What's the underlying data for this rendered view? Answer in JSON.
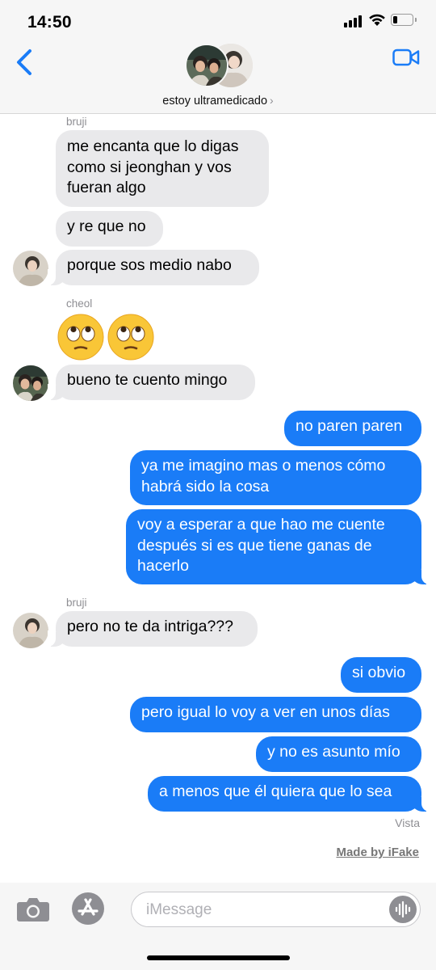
{
  "status_bar": {
    "time": "14:50",
    "battery_level": 0.25
  },
  "header": {
    "conversation_name": "estoy ultramedicado",
    "chevron": "›",
    "back_icon": "chevron-left-icon",
    "video_icon": "video-camera-icon",
    "accent_color": "#1a7cf7"
  },
  "messages": [
    {
      "sender": "bruji",
      "direction": "incoming",
      "text": "me encanta que lo digas\ncomo si jeonghan y vos\nfueran algo"
    },
    {
      "direction": "incoming",
      "text": "y re que no"
    },
    {
      "direction": "incoming",
      "text": "porque sos medio nabo"
    },
    {
      "sender": "cheol",
      "direction": "incoming",
      "emoji": "face-with-rolling-eyes x2"
    },
    {
      "direction": "incoming",
      "text": "bueno te cuento mingo"
    },
    {
      "direction": "outgoing",
      "text": "no paren paren"
    },
    {
      "direction": "outgoing",
      "text": "ya me imagino mas o menos cómo\nhabrá sido la cosa"
    },
    {
      "direction": "outgoing",
      "text": "voy a esperar a que hao me cuente\ndespués si es que tiene ganas de\nhacerlo"
    },
    {
      "sender": "bruji",
      "direction": "incoming",
      "text": "pero no te da intriga???"
    },
    {
      "direction": "outgoing",
      "text": "si obvio"
    },
    {
      "direction": "outgoing",
      "text": "pero igual lo voy a ver en unos días"
    },
    {
      "direction": "outgoing",
      "text": "y no es asunto mío"
    },
    {
      "direction": "outgoing",
      "text": "a menos que él quiera que lo sea"
    }
  ],
  "read_receipt": "Vista",
  "watermark": "Made by iFake",
  "compose": {
    "placeholder": "iMessage",
    "camera_icon": "camera-icon",
    "apps_icon": "app-store-icon",
    "audio_icon": "audio-waveform-icon"
  },
  "colors": {
    "incoming_bubble": "#e9e9eb",
    "outgoing_bubble": "#1a7cf7"
  }
}
